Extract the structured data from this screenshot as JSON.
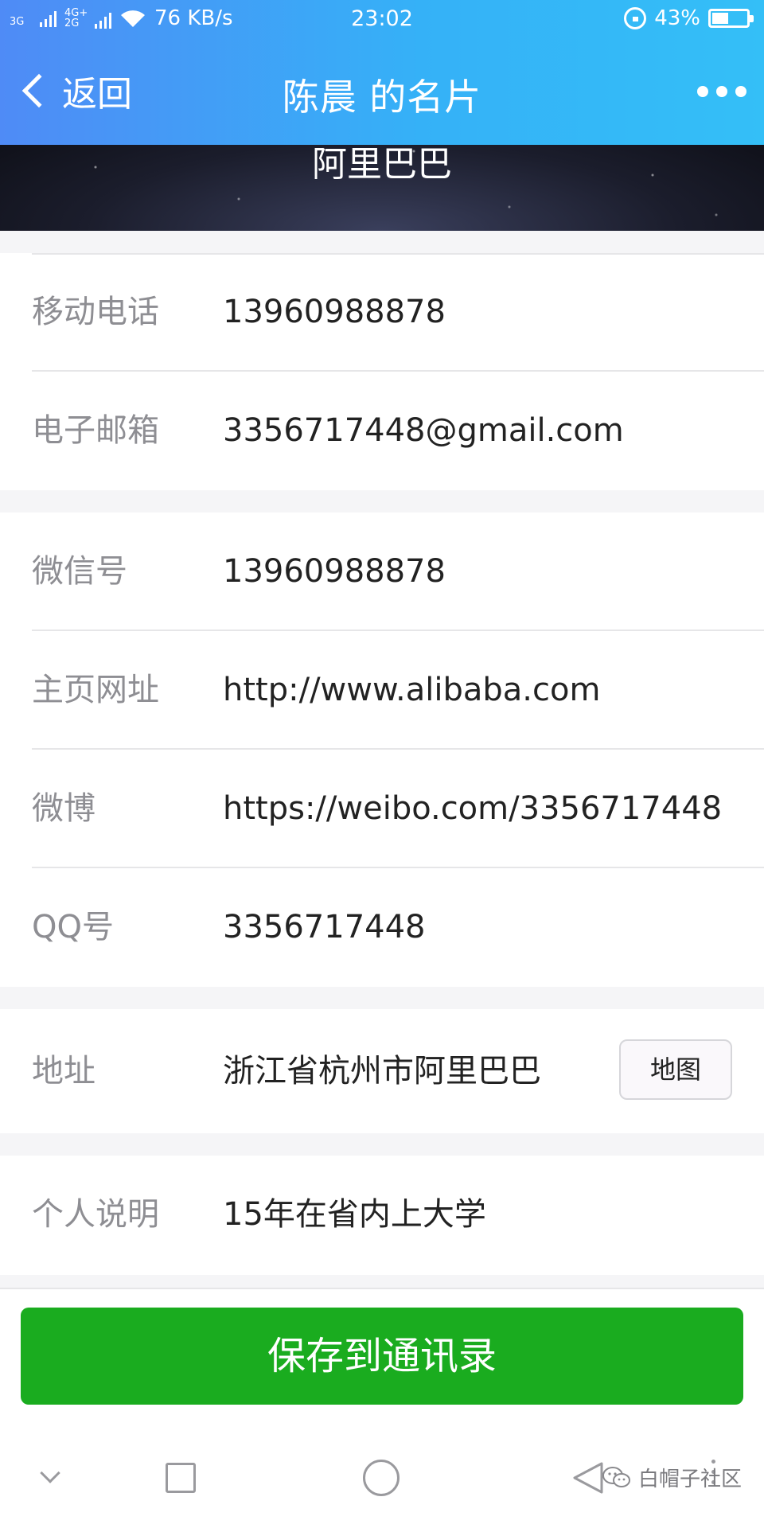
{
  "status_bar": {
    "signal_1": "3G",
    "signal_2_top": "4G+",
    "signal_2_bottom": "2G",
    "speed": "76 KB/s",
    "time": "23:02",
    "battery": "43%",
    "battery_level": 0.43
  },
  "nav": {
    "back_label": "返回",
    "title": "陈晨 的名片"
  },
  "banner": {
    "company": "阿里巴巴"
  },
  "contact_group_1": [
    {
      "label": "移动电话",
      "value": "13960988878"
    },
    {
      "label": "电子邮箱",
      "value": "3356717448@gmail.com"
    }
  ],
  "contact_group_2": [
    {
      "label": "微信号",
      "value": "13960988878"
    },
    {
      "label": "主页网址",
      "value": "http://www.alibaba.com"
    },
    {
      "label": "微博",
      "value": "https://weibo.com/3356717448"
    },
    {
      "label": "QQ号",
      "value": "3356717448"
    }
  ],
  "address": {
    "label": "地址",
    "value": "浙江省杭州市阿里巴巴",
    "map_button": "地图"
  },
  "note": {
    "label": "个人说明",
    "value": "15年在省内上大学"
  },
  "actions": {
    "save_label": "保存到通讯录"
  },
  "watermark": {
    "text": "白帽子社区"
  }
}
